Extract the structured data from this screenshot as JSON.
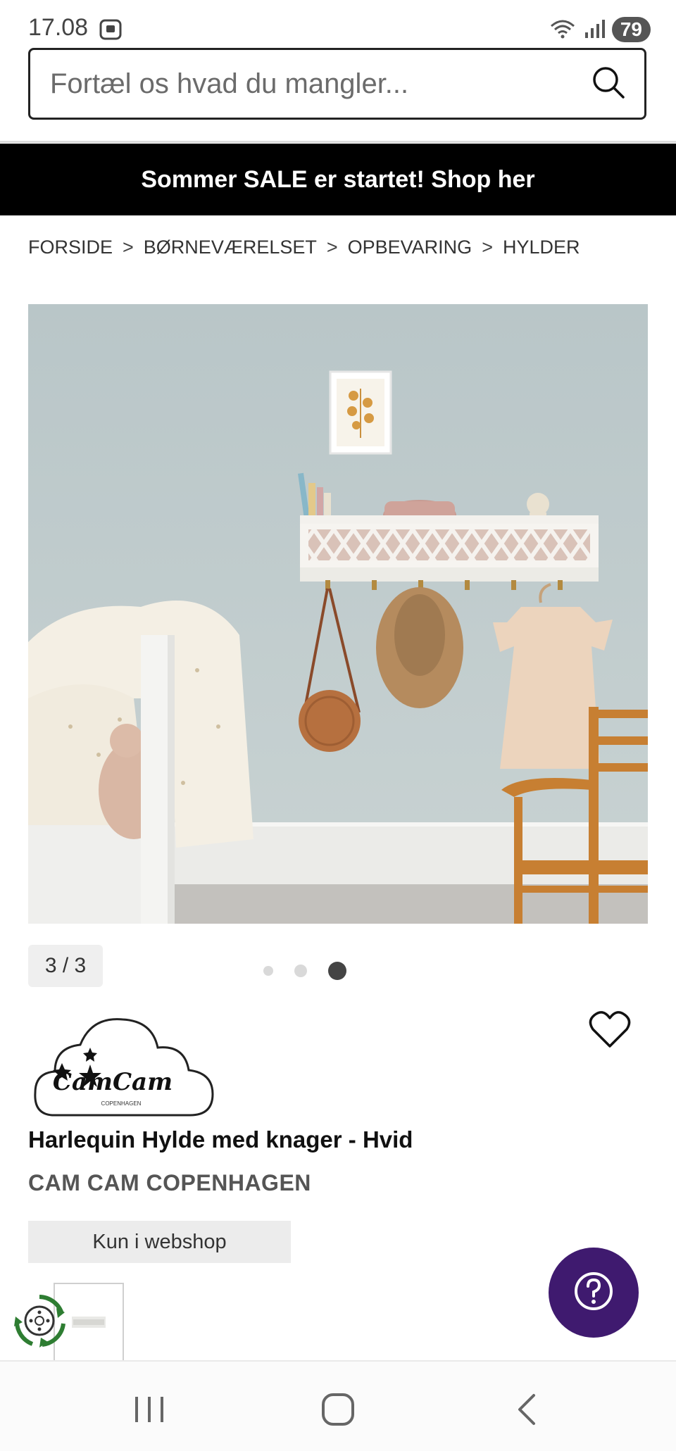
{
  "status_bar": {
    "time": "17.08",
    "battery": "79"
  },
  "search": {
    "placeholder": "Fortæl os hvad du mangler..."
  },
  "banner": {
    "text": "Sommer SALE er startet! Shop her"
  },
  "breadcrumb": {
    "items": [
      "FORSIDE",
      "BØRNEVÆRELSET",
      "OPBEVARING",
      "HYLDER"
    ],
    "separator": ">"
  },
  "gallery": {
    "counter": "3 / 3",
    "total": 3,
    "active": 3
  },
  "brand_logo": {
    "text": "CamCam",
    "subtext": "COPENHAGEN"
  },
  "product": {
    "title": "Harlequin Hylde med knager - Hvid",
    "brand": "CAM CAM COPENHAGEN",
    "availability": "Kun i webshop"
  },
  "icons": {
    "search": "search-icon",
    "favorite": "heart-icon",
    "help": "question-icon",
    "eco": "recycle-icon"
  },
  "colors": {
    "banner_bg": "#000000",
    "help_button": "#3f1a6f",
    "eco_green": "#2e7d32"
  }
}
